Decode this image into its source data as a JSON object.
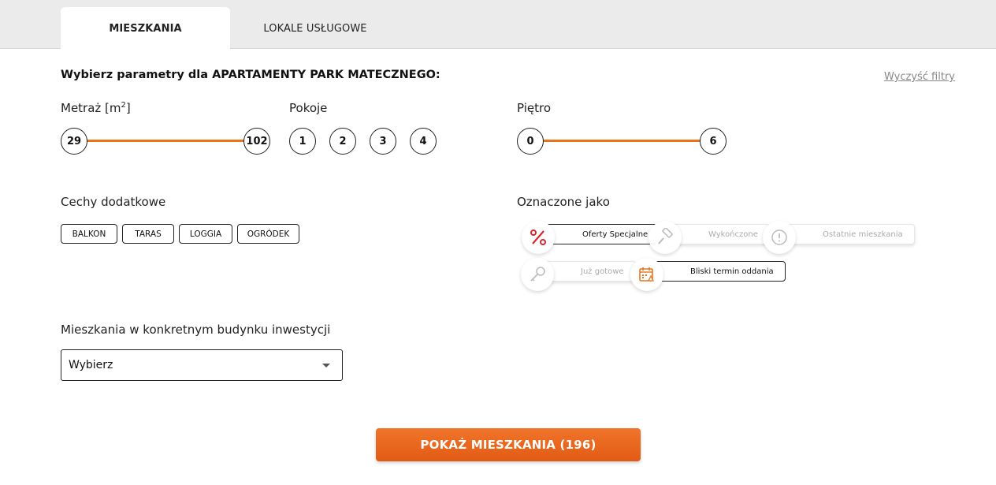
{
  "tabs": [
    {
      "label": "MIESZKANIA",
      "active": true
    },
    {
      "label": "LOKALE USŁUGOWE",
      "active": false
    }
  ],
  "heading": "Wybierz parametry dla APARTAMENTY PARK MATECZNEGO:",
  "clear_filters": "Wyczyść filtry",
  "area": {
    "label": "Metraż [m",
    "label_sup": "2",
    "label_end": "]",
    "min": "29",
    "max": "102"
  },
  "rooms": {
    "label": "Pokoje",
    "options": [
      "1",
      "2",
      "3",
      "4"
    ]
  },
  "floor": {
    "label": "Piętro",
    "min": "0",
    "max": "6"
  },
  "features": {
    "label": "Cechy dodatkowe",
    "options": [
      "BALKON",
      "TARAS",
      "LOGGIA",
      "OGRÓDEK"
    ]
  },
  "marked": {
    "label": "Oznaczone jako",
    "options": [
      {
        "label": "Oferty Specjalne",
        "active": true,
        "icon": "percent-icon"
      },
      {
        "label": "Wykończone",
        "active": false,
        "icon": "paint-roller-icon"
      },
      {
        "label": "Ostatnie mieszkania",
        "active": false,
        "icon": "alert-icon"
      },
      {
        "label": "Już gotowe",
        "active": false,
        "icon": "key-icon"
      },
      {
        "label": "Bliski termin oddania",
        "active": true,
        "icon": "calendar-icon"
      }
    ]
  },
  "building": {
    "label": "Mieszkania w konkretnym budynku inwestycji",
    "value": "Wybierz"
  },
  "cta": "POKAŻ MIESZKANIA (196)",
  "colors": {
    "accent": "#e8731c",
    "button": "#ec6a22",
    "tab_bar": "#ebebeb"
  }
}
